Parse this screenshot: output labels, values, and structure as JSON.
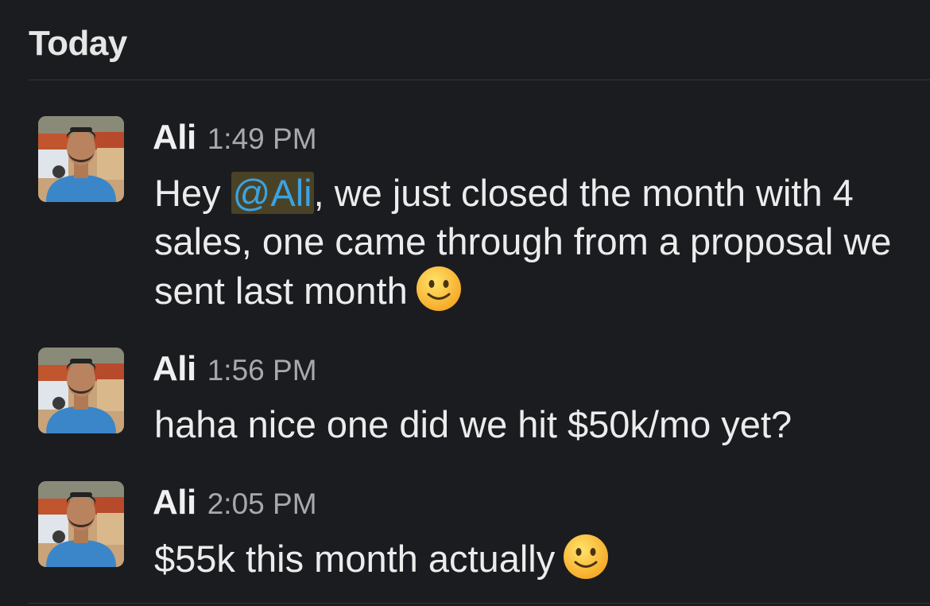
{
  "day_header": "Today",
  "messages": [
    {
      "author": "Ali",
      "time": "1:49 PM",
      "text_before": "Hey ",
      "mention": "@Ali",
      "text_after": ", we just closed the month with 4 sales, one came through from a proposal we sent last month",
      "emoji": "slightly-smiling-face-icon"
    },
    {
      "author": "Ali",
      "time": "1:56 PM",
      "text": "haha nice one did we hit $50k/mo yet?"
    },
    {
      "author": "Ali",
      "time": "2:05 PM",
      "text": "$55k this month actually",
      "emoji": "slightly-smiling-face-icon"
    }
  ],
  "colors": {
    "background": "#1b1c20",
    "mention_text": "#3aa3e3",
    "mention_background": "#4a4227",
    "timestamp": "#a8a9ad"
  }
}
